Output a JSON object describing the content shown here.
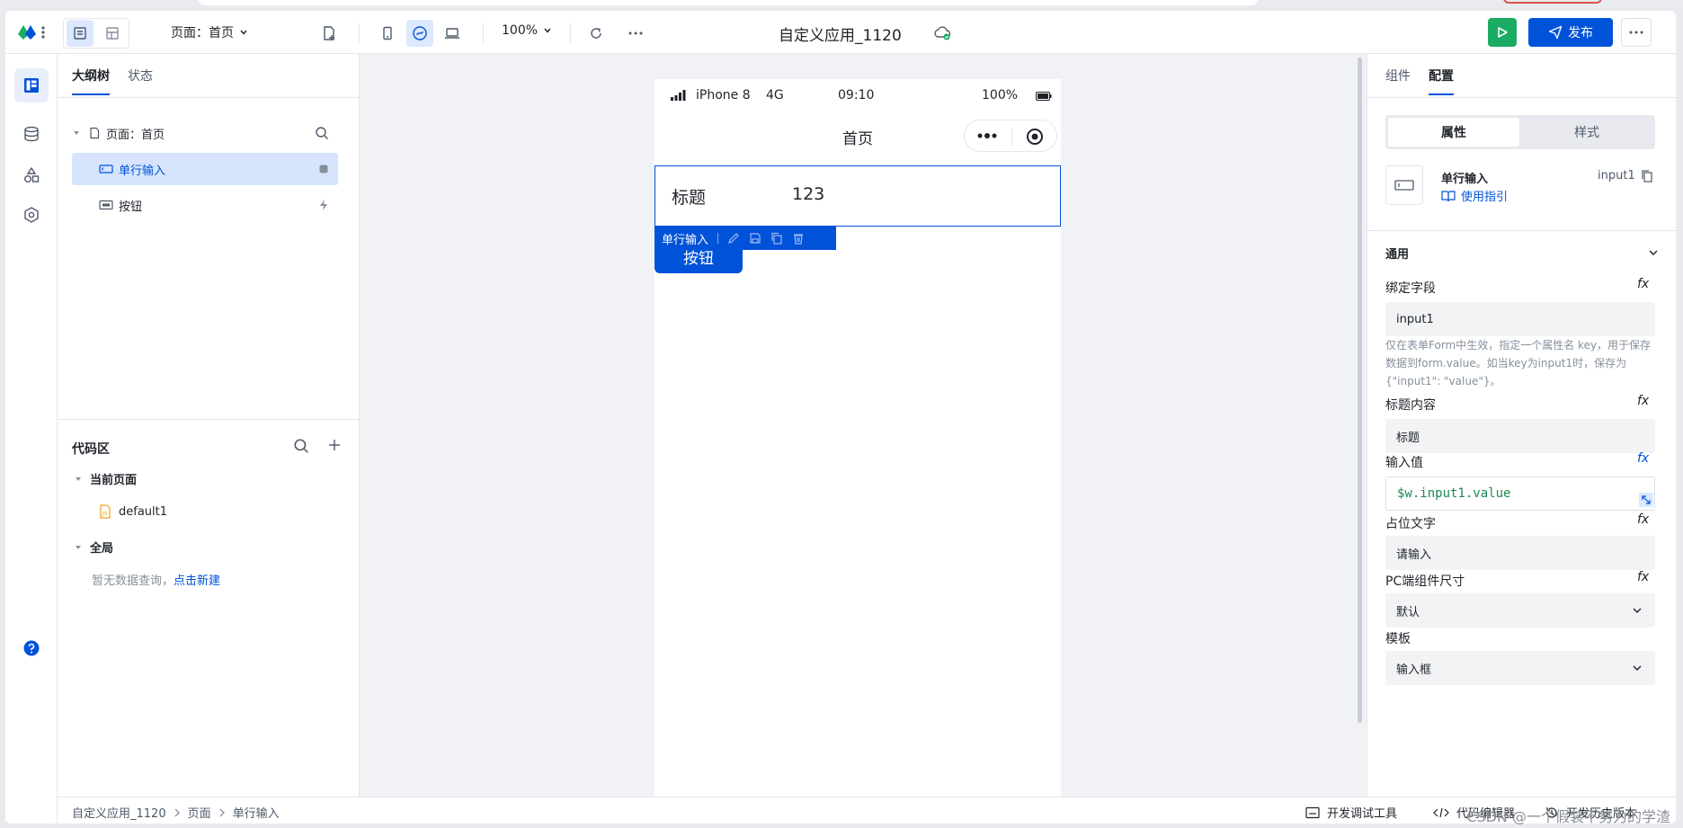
{
  "toolbar": {
    "page_selector": "页面：首页",
    "zoom": "100%",
    "app_title": "自定义应用_1120",
    "publish_label": "发布"
  },
  "outline": {
    "tabs": [
      "大纲树",
      "状态"
    ],
    "tree": {
      "page": "页面：首页",
      "items": [
        "单行输入",
        "按钮"
      ]
    }
  },
  "code": {
    "title": "代码区",
    "current_page_label": "当前页面",
    "current_page_files": [
      "default1"
    ],
    "global_label": "全局",
    "empty_text": "暂无数据查询，",
    "create_link": "点击新建"
  },
  "phone": {
    "carrier": "iPhone 8",
    "network": "4G",
    "time": "09:10",
    "battery": "100%",
    "nav_title": "首页",
    "input_label": "标题",
    "input_value": "123",
    "selection_label": "单行输入",
    "button_label": "按钮"
  },
  "config": {
    "tabs": [
      "组件",
      "配置"
    ],
    "seg": [
      "属性",
      "样式"
    ],
    "component_name": "单行输入",
    "component_id": "input1",
    "guide_link": "使用指引",
    "section_general": "通用",
    "fields": {
      "bind_label": "绑定字段",
      "bind_value": "input1",
      "help_text": "仅在表单Form中生效，指定一个属性名 key，用于保存数据到form.value。如当key为input1时，保存为{\"input1\": \"value\"}。",
      "title_label": "标题内容",
      "title_value": "标题",
      "input_label": "输入值",
      "input_value": "$w.input1.value",
      "placeholder_label": "占位文字",
      "placeholder_value": "请输入",
      "size_label": "PC端组件尺寸",
      "size_value": "默认",
      "template_label": "模板",
      "template_value": "输入框"
    },
    "fx_glyph": "fx"
  },
  "footer": {
    "breadcrumb": [
      "自定义应用_1120",
      "页面",
      "单行输入"
    ],
    "tools": [
      "开发调试工具",
      "代码编辑器",
      "开发历史版本"
    ]
  },
  "watermark": "CSDN @一个假装不努力的学渣",
  "colors": {
    "primary": "#0052d9",
    "run_green": "#1aac63",
    "selected_bg": "#d6e4fd",
    "canvas_bg": "#f0f2f5"
  }
}
